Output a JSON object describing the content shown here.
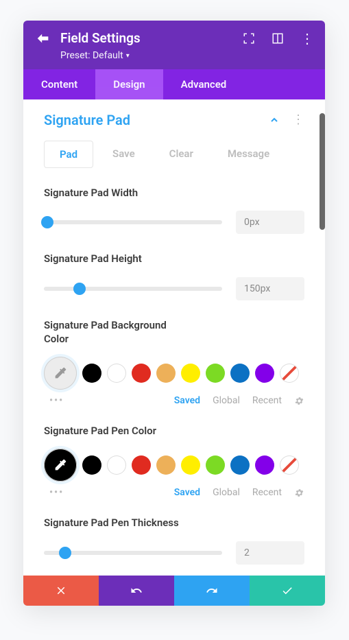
{
  "header": {
    "title": "Field Settings",
    "preset": "Preset: Default"
  },
  "tabs": {
    "content": "Content",
    "design": "Design",
    "advanced": "Advanced"
  },
  "section": {
    "title": "Signature Pad",
    "subtabs": {
      "pad": "Pad",
      "save": "Save",
      "clear": "Clear",
      "message": "Message"
    }
  },
  "fields": {
    "width": {
      "label": "Signature Pad Width",
      "value": "0px",
      "pos": 2
    },
    "height": {
      "label": "Signature Pad Height",
      "value": "150px",
      "pos": 20
    },
    "bgcolor": {
      "label": "Signature Pad Background Color"
    },
    "pencolor": {
      "label": "Signature Pad Pen Color"
    },
    "thickness": {
      "label": "Signature Pad Pen Thickness",
      "value": "2",
      "pos": 12
    }
  },
  "colorFooter": {
    "saved": "Saved",
    "global": "Global",
    "recent": "Recent"
  },
  "swatches": [
    "#000000",
    "#ffffff",
    "#e02b20",
    "#edb059",
    "#ffee00",
    "#7cda24",
    "#0c71c3",
    "#8300e9"
  ]
}
